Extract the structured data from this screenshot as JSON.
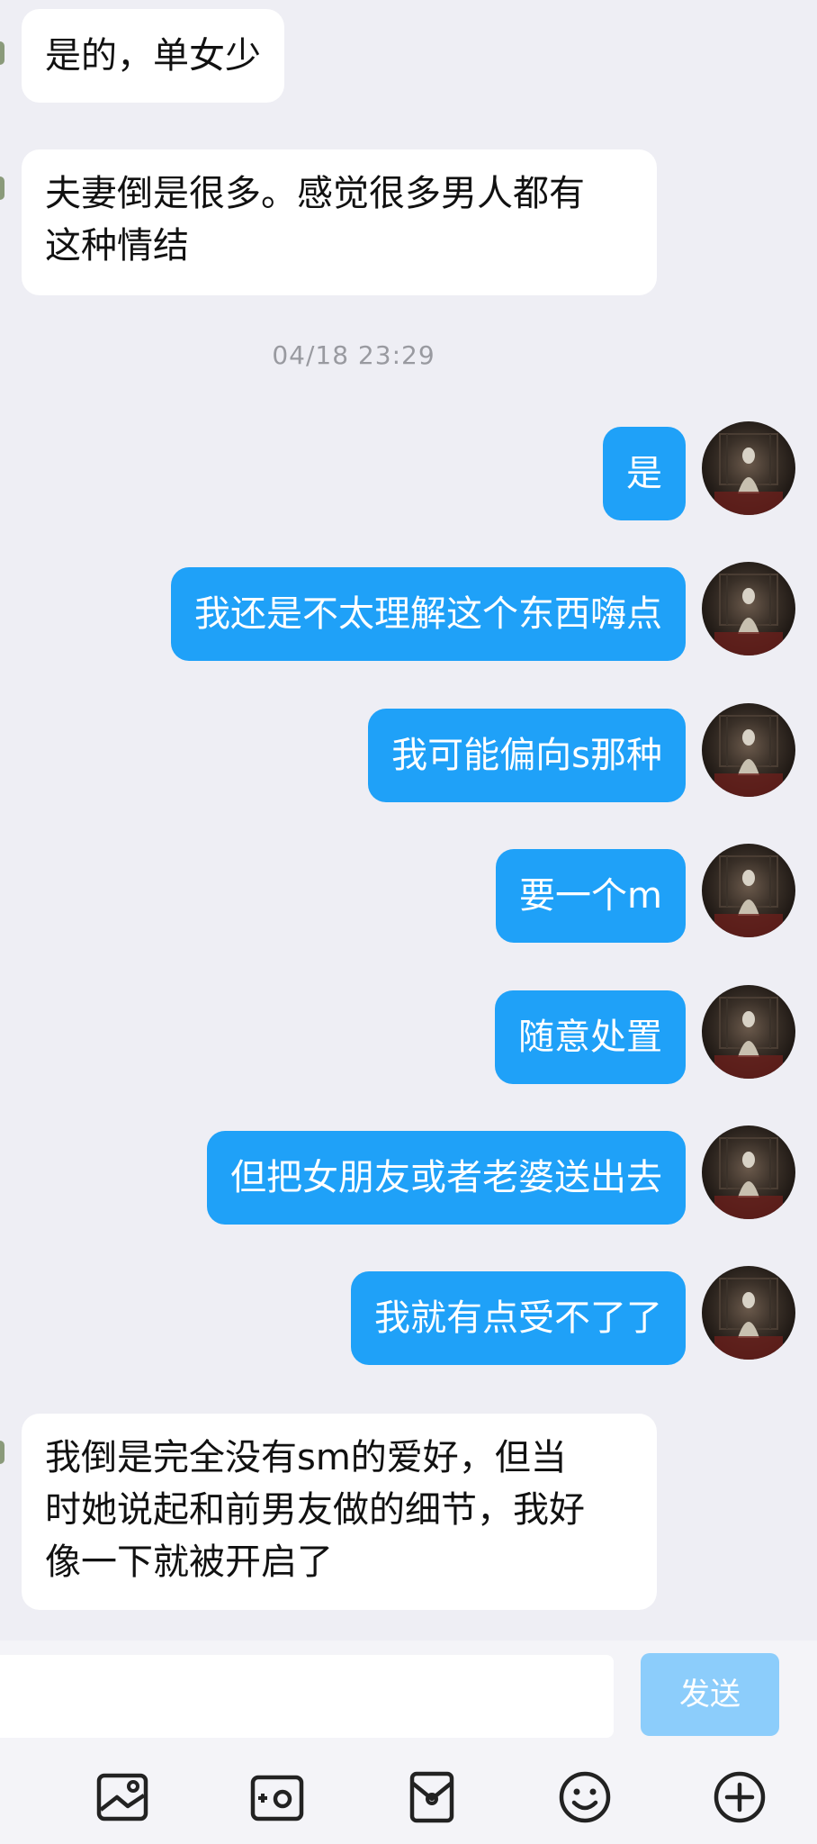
{
  "messages": [
    {
      "dir": "in",
      "text": "是的，单女少"
    },
    {
      "dir": "in",
      "lines": [
        "夫妻倒是很多。感觉很多男人都有",
        "这种情结"
      ]
    },
    {
      "dir": "out",
      "text": "是"
    },
    {
      "dir": "out",
      "text": "我还是不太理解这个东西嗨点"
    },
    {
      "dir": "out",
      "text": "我可能偏向s那种"
    },
    {
      "dir": "out",
      "text": "要一个m"
    },
    {
      "dir": "out",
      "text": "随意处置"
    },
    {
      "dir": "out",
      "text": "但把女朋友或者老婆送出去"
    },
    {
      "dir": "out",
      "text": "我就有点受不了了"
    },
    {
      "dir": "in",
      "lines": [
        "我倒是完全没有sm的爱好，但当",
        "时她说起和前男友做的细节，我好",
        "像一下就被开启了"
      ]
    }
  ],
  "timestamp": "04/18 23:29",
  "input": {
    "value": "",
    "send_label": "发送"
  },
  "toolbar": {
    "icons": [
      "image-icon",
      "camera-icon",
      "red-packet-icon",
      "emoji-icon",
      "plus-icon"
    ]
  },
  "colors": {
    "background": "#eeeef4",
    "outgoing_bubble": "#1fa1f8",
    "incoming_bubble": "#ffffff",
    "send_button": "#8ccdfb",
    "timestamp_text": "#999aa0"
  }
}
